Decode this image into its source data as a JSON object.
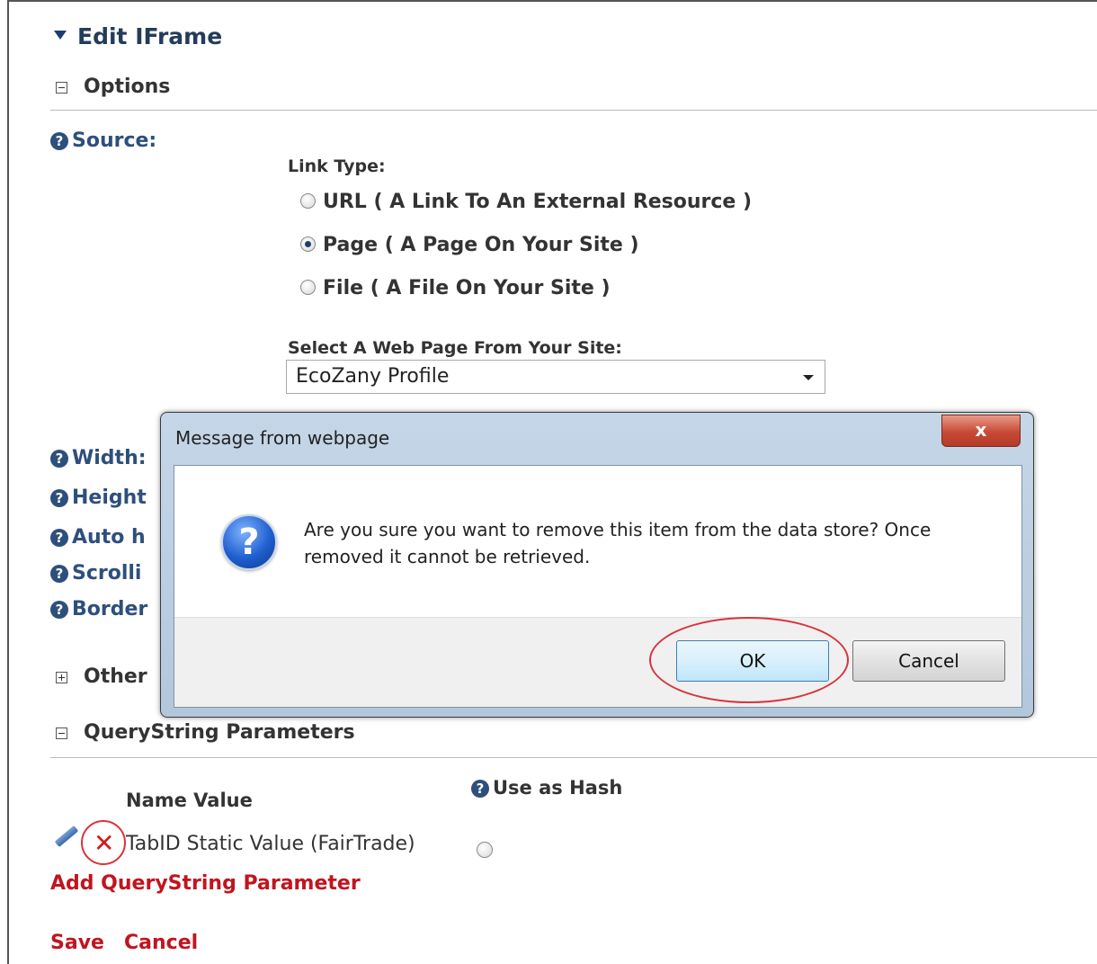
{
  "header": {
    "title": "Edit IFrame"
  },
  "options": {
    "label": "Options",
    "source_label": "Source:",
    "link_type_label": "Link Type:",
    "link_types": [
      {
        "label": "URL ( A Link To An External Resource )",
        "checked": false
      },
      {
        "label": "Page ( A Page On Your Site )",
        "checked": true
      },
      {
        "label": "File ( A File On Your Site )",
        "checked": false
      }
    ],
    "select_page_label": "Select A Web Page From Your Site:",
    "selected_page": "EcoZany Profile",
    "width_label": "Width:",
    "height_label": "Height",
    "autoheight_label": "Auto h",
    "scrolling_label": "Scrolli",
    "border_label": "Border"
  },
  "other": {
    "label": "Other"
  },
  "querystring": {
    "label": "QueryString Parameters",
    "name_value_header": "Name Value",
    "use_as_hash_label": "Use as Hash",
    "row_text": "TabID Static Value (FairTrade)",
    "add_link": "Add QueryString Parameter"
  },
  "footer": {
    "save_label": "Save",
    "cancel_label": "Cancel"
  },
  "dialog": {
    "title": "Message from webpage",
    "close_glyph": "x",
    "message_line1": "Are you sure you want to remove this item from the data store? Once",
    "message_line2": "removed it cannot be retrieved.",
    "ok_label": "OK",
    "cancel_label": "Cancel"
  },
  "colors": {
    "link_red": "#c0151f",
    "help_blue": "#2d4f7c",
    "annotation_ring": "#d8343d"
  }
}
